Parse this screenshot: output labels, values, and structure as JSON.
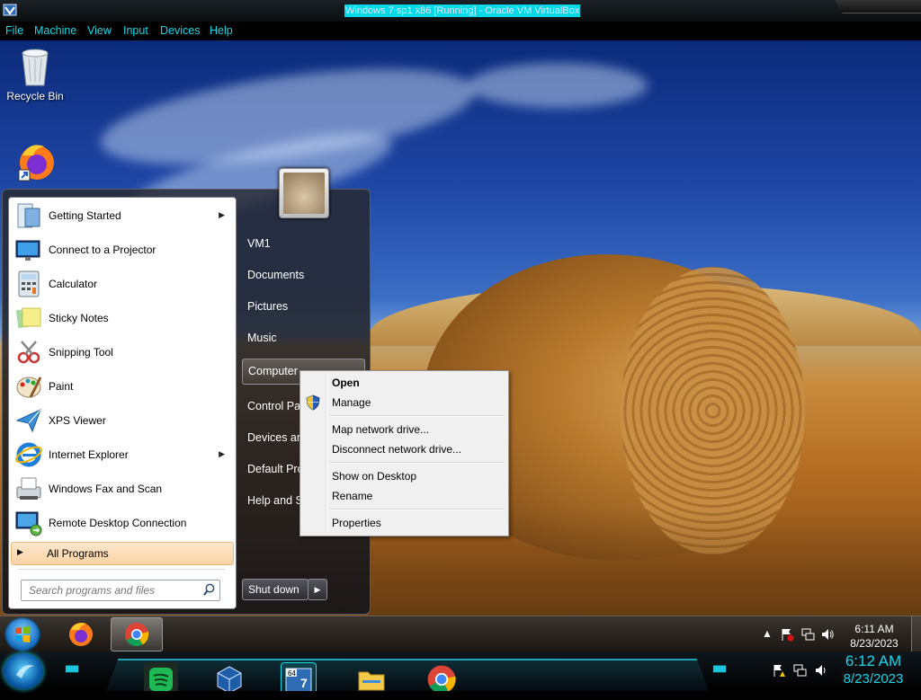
{
  "host_window": {
    "title": "Windows 7 sp1 x86 [Running] - Oracle VM VirtualBox",
    "menu": [
      "File",
      "Machine",
      "View",
      "Input",
      "Devices",
      "Help"
    ]
  },
  "desktop": {
    "icons": [
      {
        "label": "Recycle Bin",
        "icon": "recycle-bin-icon"
      },
      {
        "label": "",
        "icon": "firefox-shortcut-icon"
      }
    ]
  },
  "start_menu": {
    "programs": [
      {
        "label": "Getting Started",
        "icon": "getting-started-icon",
        "submenu": true
      },
      {
        "label": "Connect to a Projector",
        "icon": "projector-icon",
        "submenu": false
      },
      {
        "label": "Calculator",
        "icon": "calculator-icon",
        "submenu": false
      },
      {
        "label": "Sticky Notes",
        "icon": "sticky-notes-icon",
        "submenu": false
      },
      {
        "label": "Snipping Tool",
        "icon": "snipping-tool-icon",
        "submenu": false
      },
      {
        "label": "Paint",
        "icon": "paint-icon",
        "submenu": false
      },
      {
        "label": "XPS Viewer",
        "icon": "xps-viewer-icon",
        "submenu": false
      },
      {
        "label": "Internet Explorer",
        "icon": "internet-explorer-icon",
        "submenu": true
      },
      {
        "label": "Windows Fax and Scan",
        "icon": "fax-scan-icon",
        "submenu": false
      },
      {
        "label": "Remote Desktop Connection",
        "icon": "remote-desktop-icon",
        "submenu": false
      }
    ],
    "all_programs": "All Programs",
    "search_placeholder": "Search programs and files",
    "right_links": [
      "VM1",
      "Documents",
      "Pictures",
      "Music",
      "Computer",
      "Control Panel",
      "Devices and Printers",
      "Default Programs",
      "Help and Support"
    ],
    "shutdown_label": "Shut down"
  },
  "context_menu": {
    "items": [
      {
        "label": "Open",
        "bold": true,
        "icon": ""
      },
      {
        "label": "Manage",
        "bold": false,
        "icon": "uac-shield-icon"
      },
      {
        "label": "Map network drive...",
        "bold": false,
        "icon": ""
      },
      {
        "label": "Disconnect network drive...",
        "bold": false,
        "icon": ""
      },
      {
        "label": "Show on Desktop",
        "bold": false,
        "icon": ""
      },
      {
        "label": "Rename",
        "bold": false,
        "icon": ""
      },
      {
        "label": "Properties",
        "bold": false,
        "icon": ""
      }
    ]
  },
  "guest_taskbar": {
    "pinned": [
      "firefox-icon",
      "chrome-icon"
    ],
    "active": "chrome-icon",
    "clock": {
      "time": "6:11 AM",
      "date": "8/23/2023"
    }
  },
  "host_taskbar": {
    "apps": [
      "spotify-icon",
      "virtualbox-icon",
      "windows7-vm-icon",
      "file-explorer-icon",
      "chrome-icon"
    ],
    "vm_badge": "64",
    "vm_label": "7",
    "clock": {
      "time": "6:12 AM",
      "date": "8/23/2023"
    }
  },
  "colors": {
    "accent_cyan": "#19d7e8",
    "title_highlight": "#00d9e8",
    "all_programs_bg": "#fbd3a5"
  }
}
